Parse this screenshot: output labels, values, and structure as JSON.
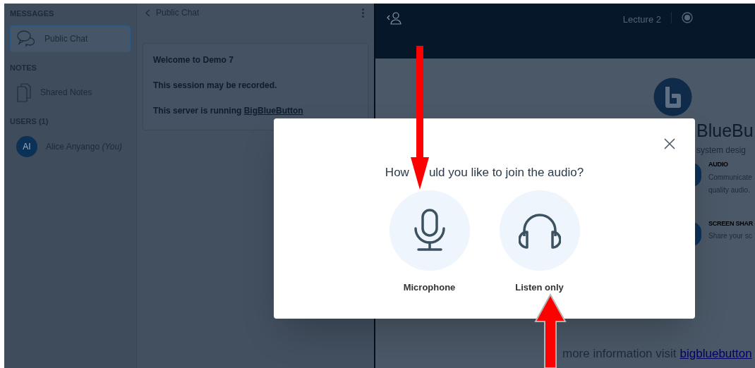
{
  "sidebar": {
    "sections": [
      {
        "title": "MESSAGES",
        "items": [
          {
            "label": "Public Chat",
            "kind": "chat",
            "selected": true
          }
        ]
      },
      {
        "title": "NOTES",
        "items": [
          {
            "label": "Shared Notes",
            "kind": "notes",
            "selected": false
          }
        ]
      },
      {
        "title": "USERS (1)",
        "items": [
          {
            "label": "Alice Anyango",
            "suffix": "(You)",
            "initials": "AI",
            "kind": "user",
            "selected": false
          }
        ]
      }
    ]
  },
  "chat": {
    "title": "Public Chat",
    "messages": [
      {
        "text": "Welcome to Demo 7"
      },
      {
        "text": "This session may be recorded."
      },
      {
        "text": "This server is running ",
        "link": "BigBlueButton"
      }
    ]
  },
  "header": {
    "title": "Lecture 2"
  },
  "presentation": {
    "title": "BlueBu",
    "subtitle": "system desig",
    "features": [
      {
        "title": "AUDIO",
        "lines": [
          "Communicate",
          "quality audio."
        ]
      },
      {
        "title": "SCREEN SHAR",
        "lines": [
          "Share your sc"
        ]
      }
    ],
    "footer": {
      "text": "more information visit",
      "link": "bigbluebutton"
    }
  },
  "modal": {
    "question_parts": [
      "How",
      "uld you like to join the audio?"
    ],
    "options": [
      {
        "label": "Microphone",
        "kind": "microphone"
      },
      {
        "label": "Listen only",
        "kind": "headphones"
      }
    ]
  }
}
